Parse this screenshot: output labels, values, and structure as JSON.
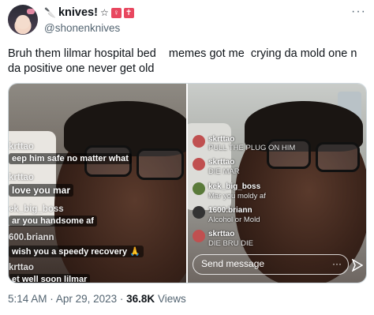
{
  "author": {
    "display_name": "knives!",
    "name_emojis": [
      "🔪",
      "☆"
    ],
    "badges": [
      "♀",
      "✝"
    ],
    "handle": "@shonenknives"
  },
  "tweet": {
    "text": "Bruh them lilmar hospital bed    memes got me  crying da mold one n da positive one never get old"
  },
  "media_left": {
    "comments": [
      {
        "user": "krttao",
        "msg": "eep him safe no matter what"
      },
      {
        "user": "krttao",
        "msg": "love you mar"
      },
      {
        "user": "ek_big_boss",
        "msg": "ar you  handsome af"
      },
      {
        "user": "600.briann",
        "msg": "wish you a speedy recovery 🙏"
      },
      {
        "user": "krttao",
        "msg": "et well soon lilmar"
      }
    ]
  },
  "media_right": {
    "comments": [
      {
        "user": "skrttao",
        "msg": "PULL THE PLUG ON HIM"
      },
      {
        "user": "skrttao",
        "msg": "DIE MAR"
      },
      {
        "user": "kek_big_boss",
        "msg": "Mar you moldy af"
      },
      {
        "user": "1600.briann",
        "msg": "Alcohol or Mold"
      },
      {
        "user": "skrttao",
        "msg": "DIE BRU DIE"
      }
    ],
    "send_placeholder": "Send message",
    "send_more": "···"
  },
  "meta": {
    "time": "5:14 AM",
    "separator": "·",
    "date": "Apr 29, 2023",
    "views_count": "36.8K",
    "views_label": "Views"
  },
  "more_label": "···",
  "colors": {
    "text": "#0f1419",
    "secondary": "#536471",
    "border": "#cfd9de",
    "badge": "#e8475f"
  }
}
